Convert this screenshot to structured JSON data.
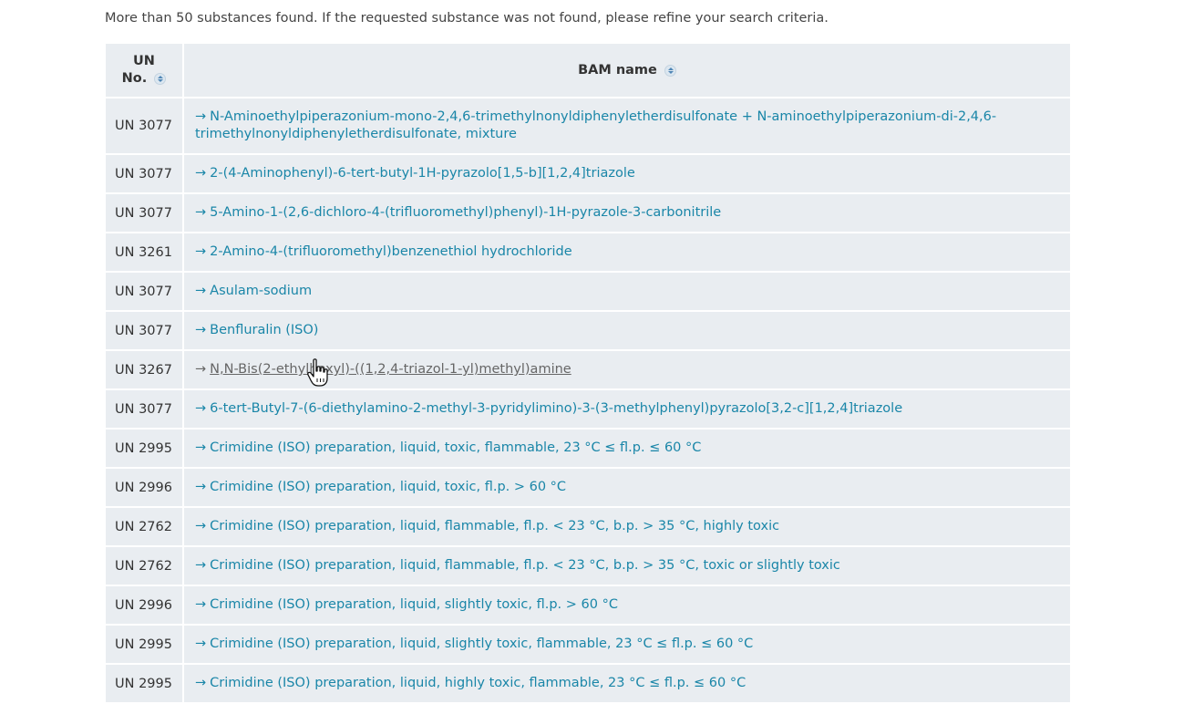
{
  "notice": "More than 50 substances found. If the requested substance was not found, please refine your search criteria.",
  "table": {
    "headers": {
      "un_line1": "UN",
      "un_line2": "No.",
      "name": "BAM name"
    },
    "arrow": "→",
    "rows": [
      {
        "un": "UN 3077",
        "name": "N-Aminoethylpiperazonium-mono-2,4,6-trimethylnonyldiphenyletherdisulfonate + N-aminoethylpiperazonium-di-2,4,6-trimethylnonyldiphenyletherdisulfonate, mixture"
      },
      {
        "un": "UN 3077",
        "name": "2-(4-Aminophenyl)-6-tert-butyl-1H-pyrazolo[1,5-b][1,2,4]triazole"
      },
      {
        "un": "UN 3077",
        "name": "5-Amino-1-(2,6-dichloro-4-(trifluoromethyl)phenyl)-1H-pyrazole-3-carbonitrile"
      },
      {
        "un": "UN 3261",
        "name": "2-Amino-4-(trifluoromethyl)benzenethiol hydrochloride"
      },
      {
        "un": "UN 3077",
        "name": "Asulam-sodium"
      },
      {
        "un": "UN 3077",
        "name": "Benfluralin (ISO)"
      },
      {
        "un": "UN 3267",
        "name": "N,N-Bis(2-ethylhexyl)-((1,2,4-triazol-1-yl)methyl)amine"
      },
      {
        "un": "UN 3077",
        "name": "6-tert-Butyl-7-(6-diethylamino-2-methyl-3-pyridylimino)-3-(3-methylphenyl)pyrazolo[3,2-c][1,2,4]triazole"
      },
      {
        "un": "UN 2995",
        "name": "Crimidine (ISO) preparation, liquid, toxic, flammable, 23 °C ≤ fl.p. ≤ 60 °C"
      },
      {
        "un": "UN 2996",
        "name": "Crimidine (ISO) preparation, liquid, toxic, fl.p. > 60 °C"
      },
      {
        "un": "UN 2762",
        "name": "Crimidine (ISO) preparation, liquid, flammable, fl.p. < 23 °C, b.p. > 35 °C, highly toxic"
      },
      {
        "un": "UN 2762",
        "name": "Crimidine (ISO) preparation, liquid, flammable, fl.p. < 23 °C, b.p. > 35 °C, toxic or slightly toxic"
      },
      {
        "un": "UN 2996",
        "name": "Crimidine (ISO) preparation, liquid, slightly toxic, fl.p. > 60 °C"
      },
      {
        "un": "UN 2995",
        "name": "Crimidine (ISO) preparation, liquid, slightly toxic, flammable, 23 °C ≤ fl.p. ≤ 60 °C"
      },
      {
        "un": "UN 2995",
        "name": "Crimidine (ISO) preparation, liquid, highly toxic, flammable, 23 °C ≤ fl.p. ≤ 60 °C"
      }
    ]
  },
  "colors": {
    "link": "#1a86a8",
    "row_bg": "#e9edf1",
    "hover_link": "#666666"
  }
}
